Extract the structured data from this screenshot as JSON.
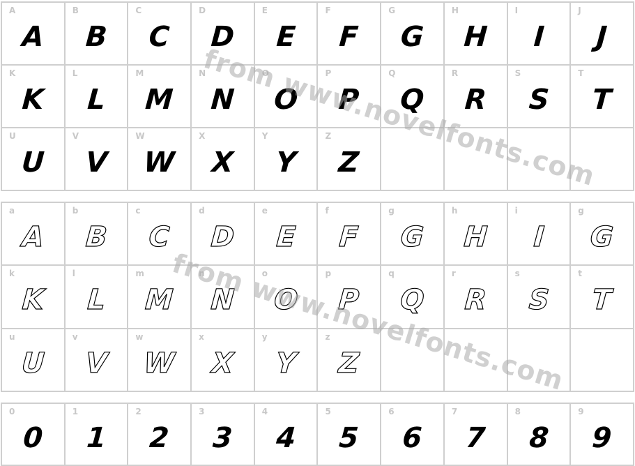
{
  "sections": [
    {
      "id": "upper",
      "style": "solid",
      "cells": [
        {
          "label": "A",
          "glyph": "A"
        },
        {
          "label": "B",
          "glyph": "B"
        },
        {
          "label": "C",
          "glyph": "C"
        },
        {
          "label": "D",
          "glyph": "D"
        },
        {
          "label": "E",
          "glyph": "E"
        },
        {
          "label": "F",
          "glyph": "F"
        },
        {
          "label": "G",
          "glyph": "G"
        },
        {
          "label": "H",
          "glyph": "H"
        },
        {
          "label": "I",
          "glyph": "I"
        },
        {
          "label": "J",
          "glyph": "J"
        },
        {
          "label": "K",
          "glyph": "K"
        },
        {
          "label": "L",
          "glyph": "L"
        },
        {
          "label": "M",
          "glyph": "M"
        },
        {
          "label": "N",
          "glyph": "N"
        },
        {
          "label": "O",
          "glyph": "O"
        },
        {
          "label": "P",
          "glyph": "P"
        },
        {
          "label": "Q",
          "glyph": "Q"
        },
        {
          "label": "R",
          "glyph": "R"
        },
        {
          "label": "S",
          "glyph": "S"
        },
        {
          "label": "T",
          "glyph": "T"
        },
        {
          "label": "U",
          "glyph": "U"
        },
        {
          "label": "V",
          "glyph": "V"
        },
        {
          "label": "W",
          "glyph": "W"
        },
        {
          "label": "X",
          "glyph": "X"
        },
        {
          "label": "Y",
          "glyph": "Y"
        },
        {
          "label": "Z",
          "glyph": "Z"
        },
        {
          "label": "",
          "glyph": ""
        },
        {
          "label": "",
          "glyph": ""
        },
        {
          "label": "",
          "glyph": ""
        },
        {
          "label": "",
          "glyph": ""
        }
      ]
    },
    {
      "id": "lower",
      "style": "outline",
      "cells": [
        {
          "label": "a",
          "glyph": "A"
        },
        {
          "label": "b",
          "glyph": "B"
        },
        {
          "label": "c",
          "glyph": "C"
        },
        {
          "label": "d",
          "glyph": "D"
        },
        {
          "label": "e",
          "glyph": "E"
        },
        {
          "label": "f",
          "glyph": "F"
        },
        {
          "label": "g",
          "glyph": "G"
        },
        {
          "label": "h",
          "glyph": "H"
        },
        {
          "label": "i",
          "glyph": "I"
        },
        {
          "label": "g",
          "glyph": "G"
        },
        {
          "label": "k",
          "glyph": "K"
        },
        {
          "label": "l",
          "glyph": "L"
        },
        {
          "label": "m",
          "glyph": "M"
        },
        {
          "label": "n",
          "glyph": "N"
        },
        {
          "label": "o",
          "glyph": "O"
        },
        {
          "label": "p",
          "glyph": "P"
        },
        {
          "label": "q",
          "glyph": "Q"
        },
        {
          "label": "r",
          "glyph": "R"
        },
        {
          "label": "s",
          "glyph": "S"
        },
        {
          "label": "t",
          "glyph": "T"
        },
        {
          "label": "u",
          "glyph": "U"
        },
        {
          "label": "v",
          "glyph": "V"
        },
        {
          "label": "w",
          "glyph": "W"
        },
        {
          "label": "x",
          "glyph": "X"
        },
        {
          "label": "y",
          "glyph": "Y"
        },
        {
          "label": "z",
          "glyph": "Z"
        },
        {
          "label": "",
          "glyph": ""
        },
        {
          "label": "",
          "glyph": ""
        },
        {
          "label": "",
          "glyph": ""
        },
        {
          "label": "",
          "glyph": ""
        }
      ]
    },
    {
      "id": "digits",
      "style": "solid",
      "cells": [
        {
          "label": "0",
          "glyph": "0"
        },
        {
          "label": "1",
          "glyph": "1"
        },
        {
          "label": "2",
          "glyph": "2"
        },
        {
          "label": "3",
          "glyph": "3"
        },
        {
          "label": "4",
          "glyph": "4"
        },
        {
          "label": "5",
          "glyph": "5"
        },
        {
          "label": "6",
          "glyph": "6"
        },
        {
          "label": "7",
          "glyph": "7"
        },
        {
          "label": "8",
          "glyph": "8"
        },
        {
          "label": "9",
          "glyph": "9"
        }
      ]
    }
  ],
  "watermark": {
    "text": "from www.novelfonts.com"
  },
  "colors": {
    "grid_line": "#cfcfcf",
    "label": "#c8c8c8",
    "glyph": "#000000",
    "watermark": "#aaaaaa"
  }
}
